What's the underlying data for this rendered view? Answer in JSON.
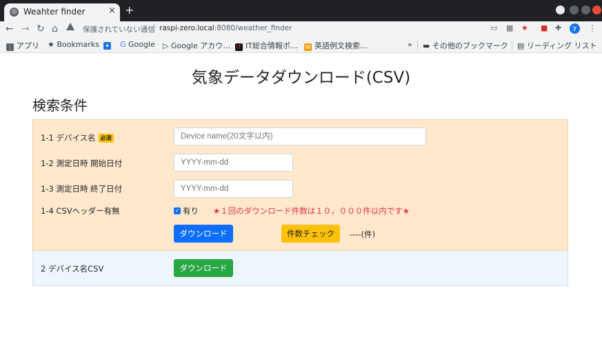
{
  "browser": {
    "tab_title": "Weahter finder",
    "tab_close": "×",
    "new_tab": "+",
    "insecure_text": "保護されていない通信",
    "url_host": "raspi-zero.local",
    "url_path": ":8080/weather_finder",
    "avatar_letter": "y"
  },
  "bookmarks": {
    "apps": "アプリ",
    "bookmarks": "Bookmarks",
    "google": "Google",
    "google_account": "Google アカウ…",
    "it_news": "IT総合情報ポ…",
    "eijiro": "英語例文検索…",
    "more": "»",
    "other": "その他のブックマーク",
    "reading_list": "リーディング リスト"
  },
  "page": {
    "title": "気象データダウンロード(CSV)",
    "section_title": "検索条件"
  },
  "form": {
    "device_label": "1-1 デバイス名",
    "required_badge": "必須",
    "device_placeholder": "Device name(20文字以内)",
    "start_label": "1-2 測定日時 開始日付",
    "start_placeholder": "YYYY-mm-dd",
    "end_label": "1-3 測定日時 終了日付",
    "end_placeholder": "YYYY-mm-dd",
    "header_label": "1-4 CSVヘッダー有無",
    "header_checkbox_label": "有り",
    "header_checked": true,
    "limit_note": "★１回のダウンロード件数は１０，０００件以内です★",
    "download_button": "ダウンロード",
    "count_button": "件数チェック",
    "count_value": "----(件)"
  },
  "device_csv": {
    "label": "2 デバイス名CSV",
    "download_button": "ダウンロード"
  },
  "colors": {
    "panel_orange": "#ffe8cc",
    "panel_blue": "#eef6fd",
    "primary": "#0d6efd",
    "warning": "#ffc107",
    "success": "#28a745",
    "danger": "#dc3545"
  }
}
